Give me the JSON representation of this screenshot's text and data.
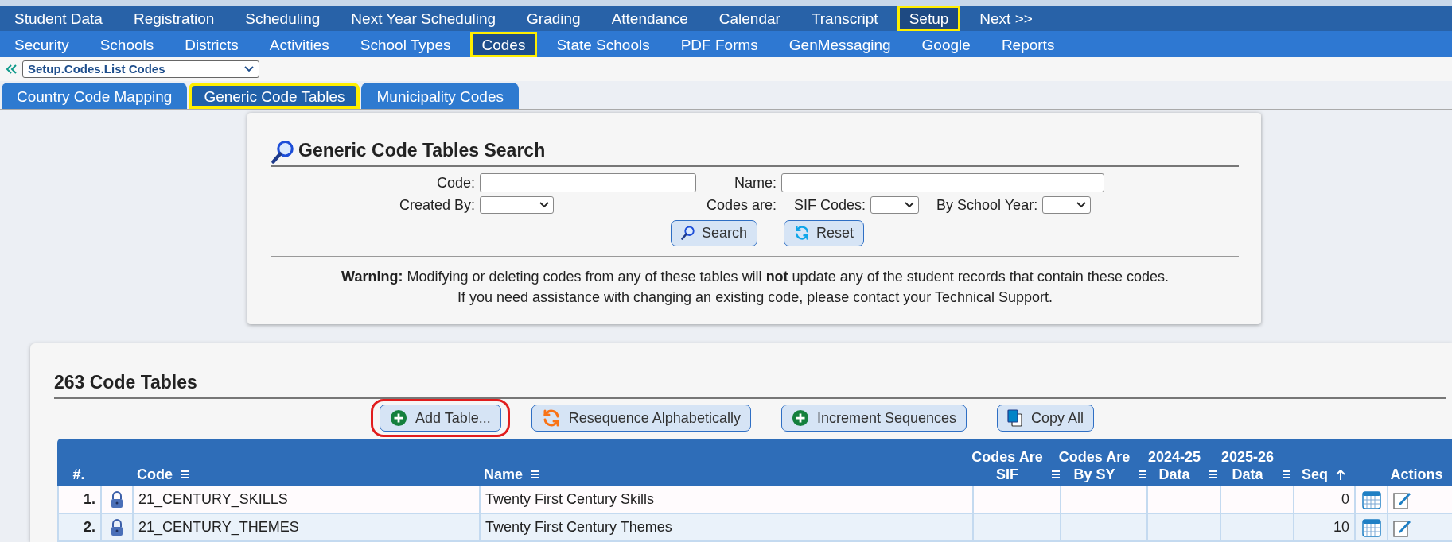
{
  "main_menu": [
    {
      "label": "Student Data",
      "selected": false,
      "highlighted": false
    },
    {
      "label": "Registration",
      "selected": false,
      "highlighted": false
    },
    {
      "label": "Scheduling",
      "selected": false,
      "highlighted": false
    },
    {
      "label": "Next Year Scheduling",
      "selected": false,
      "highlighted": false
    },
    {
      "label": "Grading",
      "selected": false,
      "highlighted": false
    },
    {
      "label": "Attendance",
      "selected": false,
      "highlighted": false
    },
    {
      "label": "Calendar",
      "selected": false,
      "highlighted": false
    },
    {
      "label": "Transcript",
      "selected": false,
      "highlighted": false
    },
    {
      "label": "Setup",
      "selected": true,
      "highlighted": true
    },
    {
      "label": "Next >>",
      "selected": false,
      "highlighted": false
    }
  ],
  "sub_menu": [
    {
      "label": "Security",
      "selected": false,
      "highlighted": false
    },
    {
      "label": "Schools",
      "selected": false,
      "highlighted": false
    },
    {
      "label": "Districts",
      "selected": false,
      "highlighted": false
    },
    {
      "label": "Activities",
      "selected": false,
      "highlighted": false
    },
    {
      "label": "School Types",
      "selected": false,
      "highlighted": false
    },
    {
      "label": "Codes",
      "selected": true,
      "highlighted": true
    },
    {
      "label": "State Schools",
      "selected": false,
      "highlighted": false
    },
    {
      "label": "PDF Forms",
      "selected": false,
      "highlighted": false
    },
    {
      "label": "GenMessaging",
      "selected": false,
      "highlighted": false
    },
    {
      "label": "Google",
      "selected": false,
      "highlighted": false
    },
    {
      "label": "Reports",
      "selected": false,
      "highlighted": false
    }
  ],
  "breadcrumb": {
    "value": "Setup.Codes.List Codes"
  },
  "tabs": [
    {
      "label": "Country Code Mapping",
      "selected": false,
      "highlighted": false
    },
    {
      "label": "Generic Code Tables",
      "selected": true,
      "highlighted": true
    },
    {
      "label": "Municipality Codes",
      "selected": false,
      "highlighted": false
    }
  ],
  "search_panel": {
    "title": "Generic Code Tables Search",
    "code_label": "Code:",
    "name_label": "Name:",
    "created_by_label": "Created By:",
    "codes_are_label": "Codes are:",
    "sif_label": "SIF Codes:",
    "school_year_label": "By School Year:",
    "buttons": [
      {
        "label": "Search",
        "kind": "search"
      },
      {
        "label": "Reset",
        "kind": "reset"
      }
    ],
    "warning": "**Warning:** Modifying or deleting codes from any of these tables will **not** update any of the student records that contain these codes.",
    "note": "If you need assistance with changing an existing code, please contact your Technical Support."
  },
  "code_tables": {
    "title": "263 Code Tables",
    "buttons": [
      {
        "label": "Add Table...",
        "kind": "add",
        "circled": true
      },
      {
        "label": "Resequence Alphabetically",
        "kind": "resequence",
        "circled": false
      },
      {
        "label": "Increment Sequences",
        "kind": "add",
        "circled": false
      },
      {
        "label": "Copy All",
        "kind": "copy",
        "circled": false
      }
    ],
    "columns": [
      {
        "lines": [
          "#."
        ]
      },
      {
        "lines": [
          "Code"
        ]
      },
      {
        "lines": [
          "Name"
        ]
      },
      {
        "lines": [
          "Codes Are",
          "SIF"
        ]
      },
      {
        "lines": [
          "Codes Are",
          "By SY"
        ]
      },
      {
        "lines": [
          "2024-25",
          "Data"
        ]
      },
      {
        "lines": [
          "2025-26",
          "Data"
        ]
      },
      {
        "lines": [
          "Seq"
        ]
      },
      {
        "lines": [
          "Actions"
        ]
      }
    ],
    "rows": [
      {
        "number": "1.",
        "locked": true,
        "code": "21_CENTURY_SKILLS",
        "name": "Twenty First Century Skills",
        "seq": "0"
      },
      {
        "number": "2.",
        "locked": true,
        "code": "21_CENTURY_THEMES",
        "name": "Twenty First Century Themes",
        "seq": "10"
      }
    ]
  }
}
